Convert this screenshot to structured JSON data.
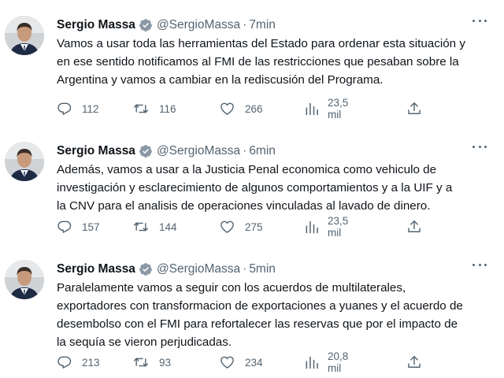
{
  "icons": {
    "verified": "verified-badge-icon",
    "reply": "reply-icon",
    "retweet": "retweet-icon",
    "like": "heart-icon",
    "views": "views-icon",
    "share": "share-icon",
    "more": "more-icon"
  },
  "colors": {
    "text": "#0f1419",
    "secondary": "#536471",
    "verified_badge": "#8b98a5"
  },
  "tweets": [
    {
      "name": "Sergio Massa",
      "handle": "@SergioMassa",
      "separator": "·",
      "time": "7min",
      "lines": [
        "Vamos a usar toda las herramientas del Estado para ordenar esta situación y",
        "en ese sentido notificamos al FMI de las restricciones que pesaban sobre la",
        "Argentina y vamos a cambiar en la rediscusión del Programa."
      ],
      "replies": "112",
      "retweets": "116",
      "likes": "266",
      "views": "23,5 mil"
    },
    {
      "name": "Sergio Massa",
      "handle": "@SergioMassa",
      "separator": "·",
      "time": "6min",
      "lines": [
        "Además, vamos a usar a la Justicia Penal economica como vehiculo de",
        "investigación y esclarecimiento de algunos comportamientos y a la UIF y a",
        "la CNV para el analisis de operaciones vinculadas al lavado de dinero."
      ],
      "replies": "157",
      "retweets": "144",
      "likes": "275",
      "views": "23,5 mil"
    },
    {
      "name": "Sergio Massa",
      "handle": "@SergioMassa",
      "separator": "·",
      "time": "5min",
      "lines": [
        "Paralelamente vamos a seguir con los acuerdos de multilaterales,",
        "exportadores con transformacion de exportaciones a yuanes y el acuerdo de",
        "desembolso con el FMI para refortalecer las reservas que por el impacto de",
        "la sequía se vieron perjudicadas."
      ],
      "replies": "213",
      "retweets": "93",
      "likes": "234",
      "views": "20,8 mil"
    }
  ]
}
